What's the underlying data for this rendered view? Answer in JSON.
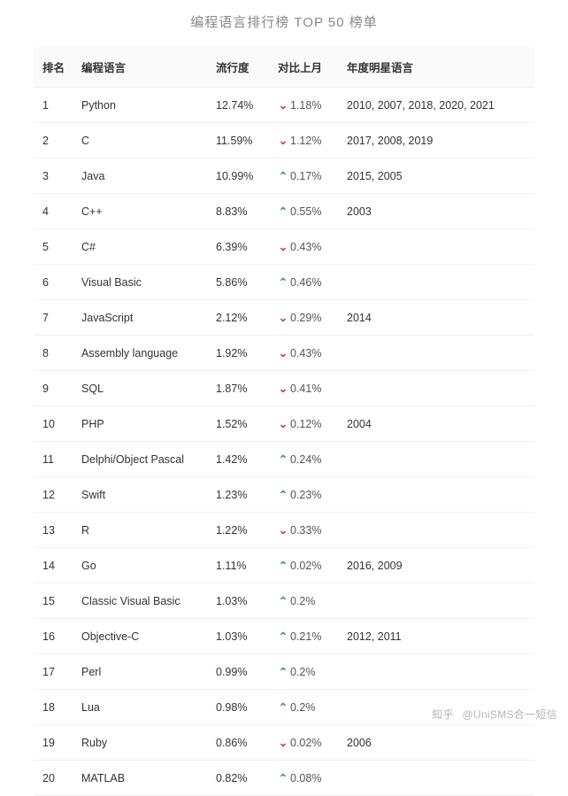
{
  "title": "编程语言排行榜 TOP 50 榜单",
  "columns": {
    "rank": "排名",
    "language": "编程语言",
    "popularity": "流行度",
    "change": "对比上月",
    "year_star": "年度明星语言"
  },
  "icons": {
    "up": "⌃",
    "down": "⌄"
  },
  "watermark": {
    "site": "知乎",
    "author": "@UniSMS合一短信"
  },
  "chart_data": {
    "type": "table",
    "rows": [
      {
        "rank": 1,
        "language": "Python",
        "popularity": "12.74%",
        "change_dir": "down",
        "change": "1.18%",
        "year_star": "2010, 2007, 2018, 2020, 2021"
      },
      {
        "rank": 2,
        "language": "C",
        "popularity": "11.59%",
        "change_dir": "down",
        "change": "1.12%",
        "year_star": "2017, 2008, 2019"
      },
      {
        "rank": 3,
        "language": "Java",
        "popularity": "10.99%",
        "change_dir": "up",
        "change": "0.17%",
        "year_star": "2015, 2005"
      },
      {
        "rank": 4,
        "language": "C++",
        "popularity": "8.83%",
        "change_dir": "up",
        "change": "0.55%",
        "year_star": "2003"
      },
      {
        "rank": 5,
        "language": "C#",
        "popularity": "6.39%",
        "change_dir": "down",
        "change": "0.43%",
        "year_star": ""
      },
      {
        "rank": 6,
        "language": "Visual Basic",
        "popularity": "5.86%",
        "change_dir": "up",
        "change": "0.46%",
        "year_star": ""
      },
      {
        "rank": 7,
        "language": "JavaScript",
        "popularity": "2.12%",
        "change_dir": "down",
        "change": "0.29%",
        "year_star": "2014"
      },
      {
        "rank": 8,
        "language": "Assembly language",
        "popularity": "1.92%",
        "change_dir": "down",
        "change": "0.43%",
        "year_star": ""
      },
      {
        "rank": 9,
        "language": "SQL",
        "popularity": "1.87%",
        "change_dir": "down",
        "change": "0.41%",
        "year_star": ""
      },
      {
        "rank": 10,
        "language": "PHP",
        "popularity": "1.52%",
        "change_dir": "down",
        "change": "0.12%",
        "year_star": "2004"
      },
      {
        "rank": 11,
        "language": "Delphi/Object Pascal",
        "popularity": "1.42%",
        "change_dir": "up",
        "change": "0.24%",
        "year_star": ""
      },
      {
        "rank": 12,
        "language": "Swift",
        "popularity": "1.23%",
        "change_dir": "up",
        "change": "0.23%",
        "year_star": ""
      },
      {
        "rank": 13,
        "language": "R",
        "popularity": "1.22%",
        "change_dir": "down",
        "change": "0.33%",
        "year_star": ""
      },
      {
        "rank": 14,
        "language": "Go",
        "popularity": "1.11%",
        "change_dir": "up",
        "change": "0.02%",
        "year_star": "2016, 2009"
      },
      {
        "rank": 15,
        "language": "Classic Visual Basic",
        "popularity": "1.03%",
        "change_dir": "up",
        "change": "0.2%",
        "year_star": ""
      },
      {
        "rank": 16,
        "language": "Objective-C",
        "popularity": "1.03%",
        "change_dir": "up",
        "change": "0.21%",
        "year_star": "2012, 2011"
      },
      {
        "rank": 17,
        "language": "Perl",
        "popularity": "0.99%",
        "change_dir": "up",
        "change": "0.2%",
        "year_star": ""
      },
      {
        "rank": 18,
        "language": "Lua",
        "popularity": "0.98%",
        "change_dir": "up",
        "change": "0.2%",
        "year_star": ""
      },
      {
        "rank": 19,
        "language": "Ruby",
        "popularity": "0.86%",
        "change_dir": "down",
        "change": "0.02%",
        "year_star": "2006"
      },
      {
        "rank": 20,
        "language": "MATLAB",
        "popularity": "0.82%",
        "change_dir": "up",
        "change": "0.08%",
        "year_star": ""
      }
    ]
  }
}
